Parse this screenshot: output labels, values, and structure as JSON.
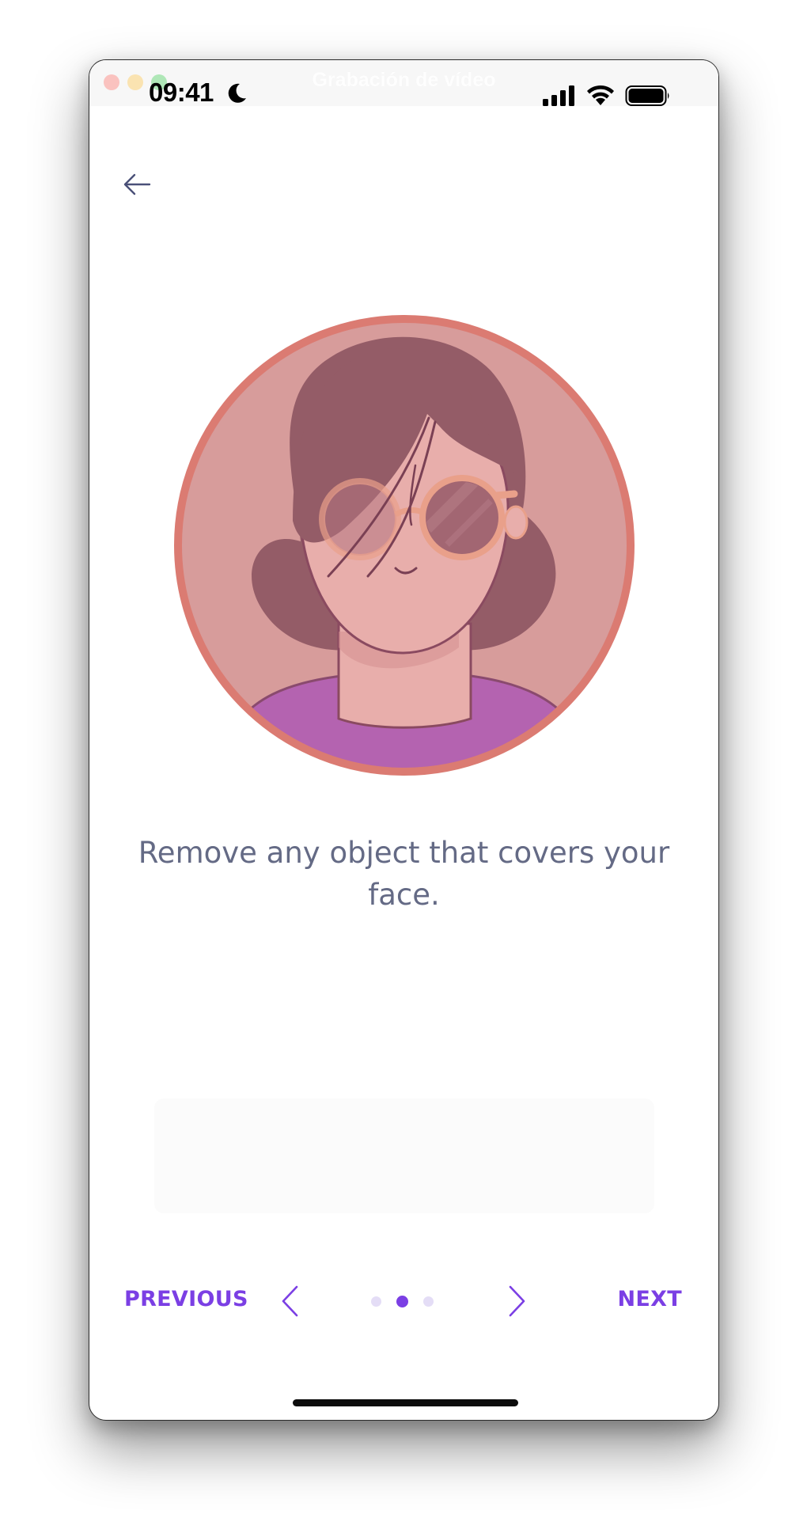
{
  "status_bar": {
    "time": "09:41",
    "recording_title": "Grabación de vídeo"
  },
  "screen": {
    "instruction_text": "Remove any object that covers your face.",
    "illustration": "woman-with-sunglasses-illustration"
  },
  "navigation": {
    "previous_label": "PREVIOUS",
    "next_label": "NEXT",
    "page_count": 3,
    "current_page": 2
  },
  "colors": {
    "accent": "#7b3fe4",
    "text_muted": "#646a85",
    "ring": "#db7b72",
    "avatar_bg": "#d79c9b",
    "hair": "#945c67",
    "skin": "#e8aeab",
    "shirt": "#b463b0",
    "glasses": "#e9a08a"
  }
}
